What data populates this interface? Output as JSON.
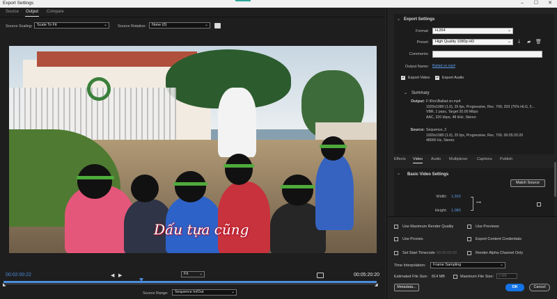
{
  "window": {
    "title": "Export Settings",
    "minimize": "–",
    "maximize": "☐",
    "close": "✕"
  },
  "tabs": [
    {
      "label": "Source"
    },
    {
      "label": "Output"
    },
    {
      "label": "Compare"
    }
  ],
  "source_scaling": {
    "label": "Source Scaling:",
    "value": "Scale To Fit"
  },
  "source_rotation": {
    "label": "Source Rotation:",
    "value": "None (0)"
  },
  "preview": {
    "caption": "Dấu tựa cũng"
  },
  "timeline": {
    "current_time": "00:02:00:22",
    "duration": "00:05:20:20",
    "zoom": "Fit",
    "source_range_label": "Source Range:",
    "source_range": "Sequence In/Out",
    "playhead_progress": 0.37
  },
  "export_settings": {
    "title": "Export Settings",
    "format_label": "Format:",
    "format": "H.264",
    "preset_label": "Preset:",
    "preset": "High Quality 1080p HD",
    "comments_label": "Comments:",
    "comments": "",
    "output_name_label": "Output Name:",
    "output_name": "Ballad.vn.mp4",
    "export_video_label": "Export Video",
    "export_audio_label": "Export Audio",
    "export_video": true,
    "export_audio": true
  },
  "summary": {
    "title": "Summary",
    "output_label": "Output:",
    "output_lines": [
      "F:\\Roc\\Ballad.vn.mp4",
      "1920x1080 (1.0), 25 fps, Progressive, Rec. 709, 203 (75% HLG, 5...",
      "VBR, 1 pass, Target 20.00 Mbps",
      "AAC, 320 kbps, 48 kHz, Stereo"
    ],
    "source_label": "Source:",
    "source_lines": [
      "Sequence, 2",
      "1920x1080 (1.0), 25 fps, Progressive, Rec. 709, 00:05:20:20",
      "48000 Hz, Stereo"
    ]
  },
  "settings_tabs": [
    {
      "label": "Effects"
    },
    {
      "label": "Video"
    },
    {
      "label": "Audio"
    },
    {
      "label": "Multiplexer"
    },
    {
      "label": "Captions"
    },
    {
      "label": "Publish"
    }
  ],
  "basic_video": {
    "title": "Basic Video Settings",
    "match_source": "Match Source",
    "width_label": "Width:",
    "width": "1,920",
    "height_label": "Height:",
    "height": "1,080"
  },
  "options": {
    "max_render_quality": "Use Maximum Render Quality",
    "use_previews": "Use Previews",
    "use_proxies": "Use Proxies",
    "export_content_credentials": "Export Content Credentials",
    "set_start_timecode": "Set Start Timecode",
    "start_timecode_value": "00:00:00:00",
    "render_alpha_only": "Render Alpha Channel Only",
    "time_interp_label": "Time Interpolation:",
    "time_interp": "Frame Sampling",
    "est_size_label": "Estimated File Size:",
    "est_size": "814 MB",
    "max_file_size_label": "Maximum File Size:",
    "max_file_size_value": "0 MB"
  },
  "buttons": {
    "metadata": "Metadata...",
    "ok": "OK",
    "cancel": "Cancel"
  },
  "colors": {
    "accent_blue": "#1473e6",
    "timecode_blue": "#4d8ddf"
  }
}
